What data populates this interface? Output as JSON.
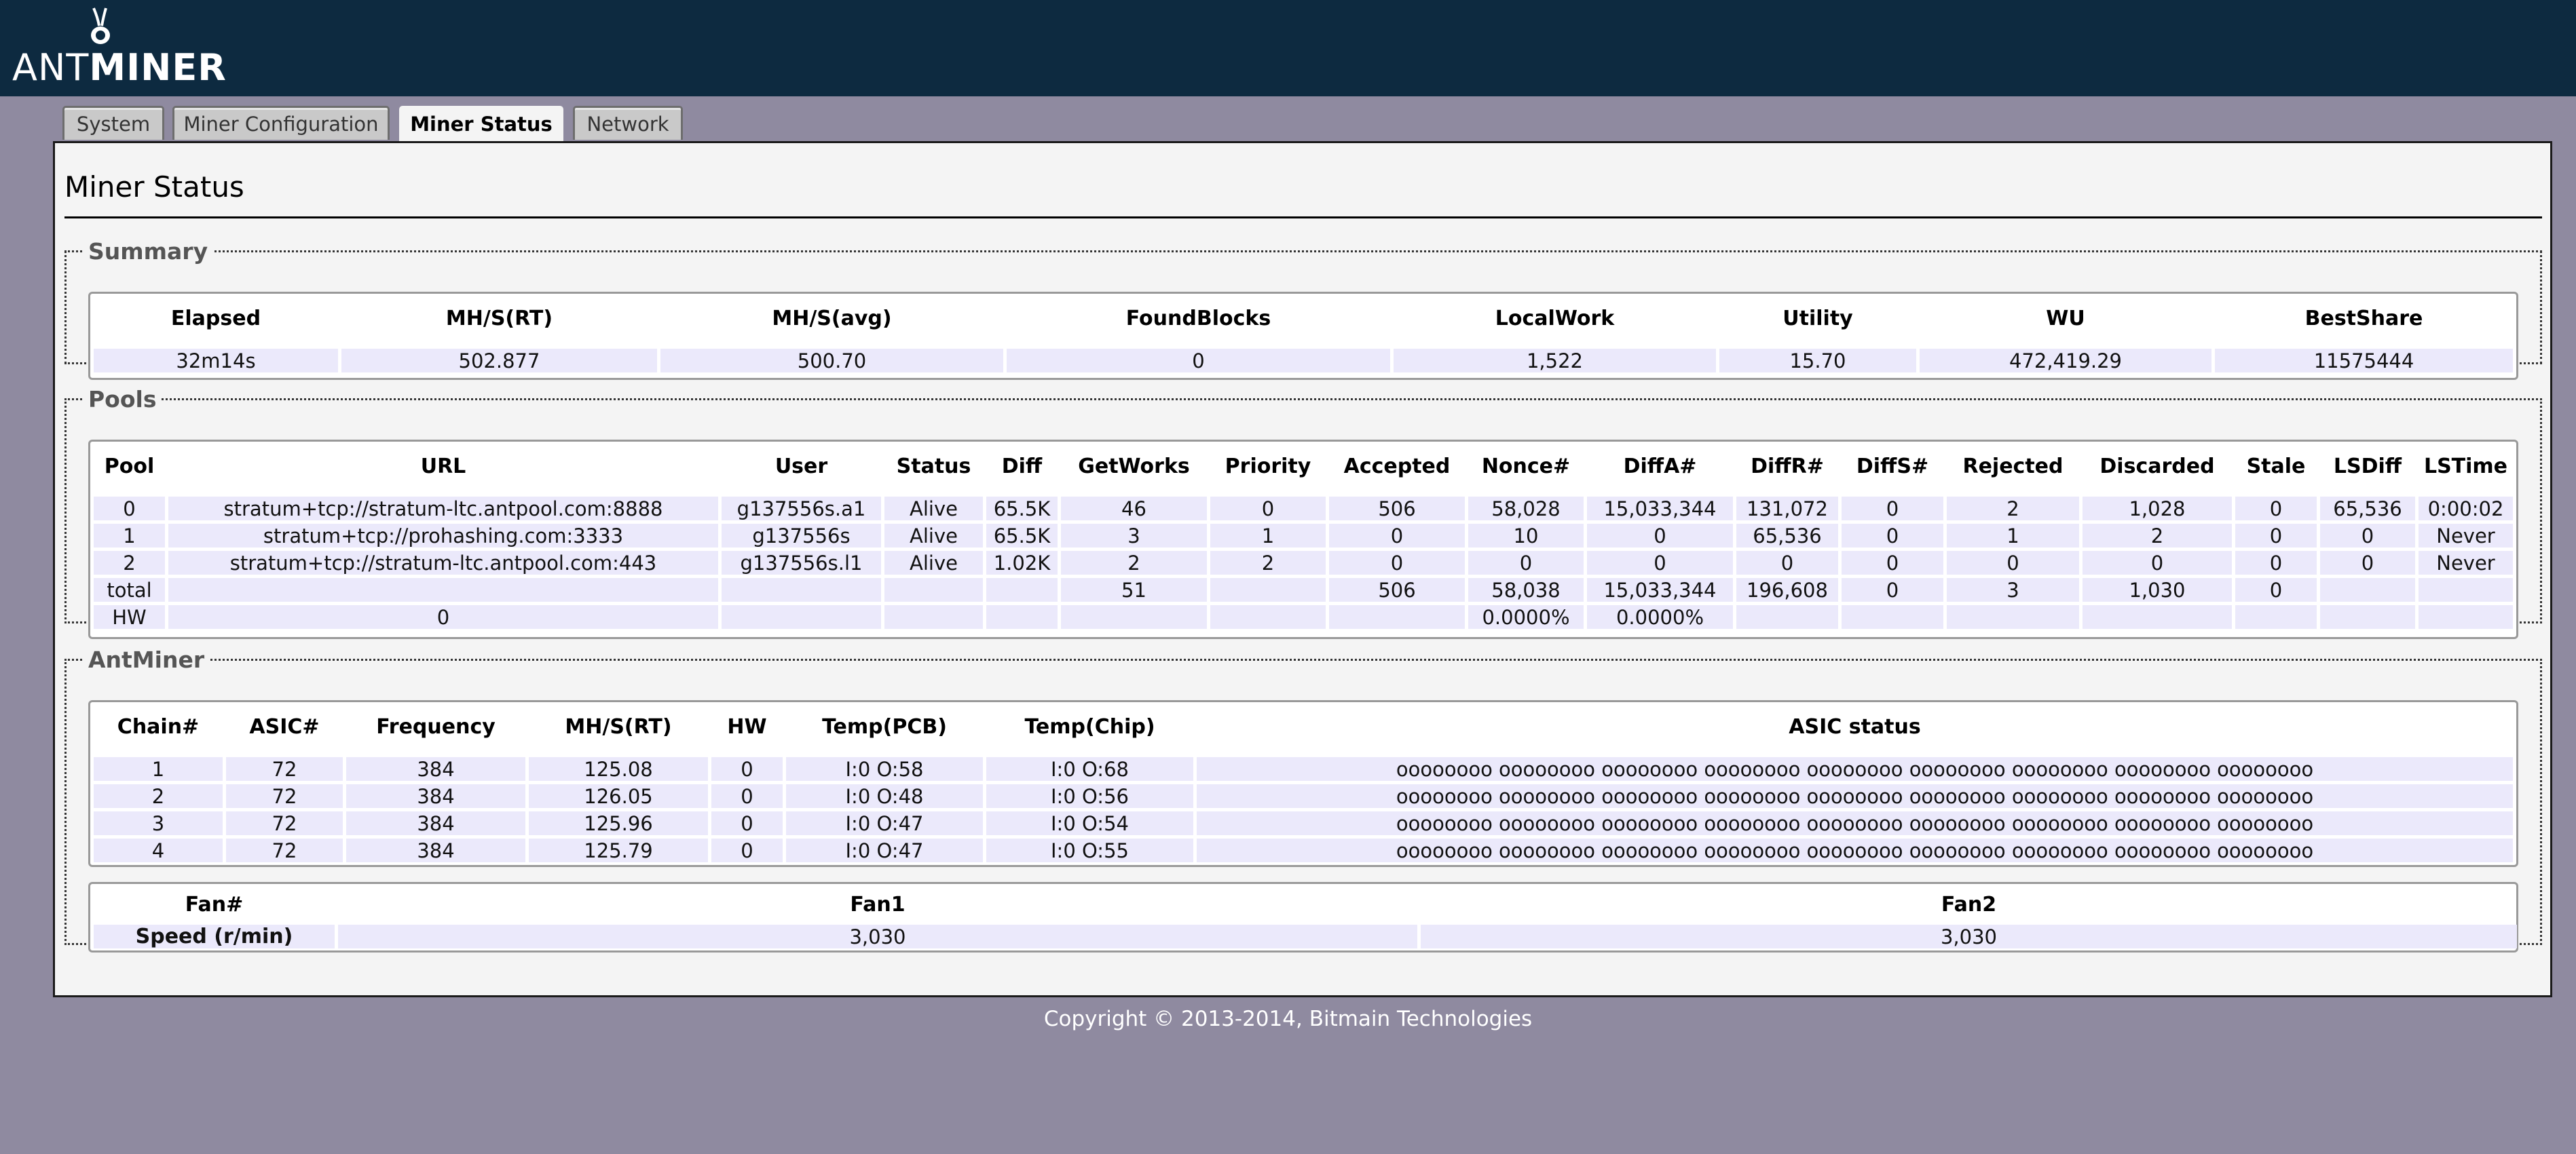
{
  "brand": {
    "part1": "ANT",
    "part2": "MINER"
  },
  "tabs": [
    "System",
    "Miner Configuration",
    "Miner Status",
    "Network"
  ],
  "page_title": "Miner Status",
  "summary": {
    "legend": "Summary",
    "headers": [
      "Elapsed",
      "MH/S(RT)",
      "MH/S(avg)",
      "FoundBlocks",
      "LocalWork",
      "Utility",
      "WU",
      "BestShare"
    ],
    "values": [
      "32m14s",
      "502.877",
      "500.70",
      "0",
      "1,522",
      "15.70",
      "472,419.29",
      "11575444"
    ]
  },
  "pools": {
    "legend": "Pools",
    "headers": [
      "Pool",
      "URL",
      "User",
      "Status",
      "Diff",
      "GetWorks",
      "Priority",
      "Accepted",
      "Nonce#",
      "DiffA#",
      "DiffR#",
      "DiffS#",
      "Rejected",
      "Discarded",
      "Stale",
      "LSDiff",
      "LSTime"
    ],
    "rows": [
      [
        "0",
        "stratum+tcp://stratum-ltc.antpool.com:8888",
        "g137556s.a1",
        "Alive",
        "65.5K",
        "46",
        "0",
        "506",
        "58,028",
        "15,033,344",
        "131,072",
        "0",
        "2",
        "1,028",
        "0",
        "65,536",
        "0:00:02"
      ],
      [
        "1",
        "stratum+tcp://prohashing.com:3333",
        "g137556s",
        "Alive",
        "65.5K",
        "3",
        "1",
        "0",
        "10",
        "0",
        "65,536",
        "0",
        "1",
        "2",
        "0",
        "0",
        "Never"
      ],
      [
        "2",
        "stratum+tcp://stratum-ltc.antpool.com:443",
        "g137556s.l1",
        "Alive",
        "1.02K",
        "2",
        "2",
        "0",
        "0",
        "0",
        "0",
        "0",
        "0",
        "0",
        "0",
        "0",
        "Never"
      ],
      [
        "total",
        "",
        "",
        "",
        "",
        "51",
        "",
        "506",
        "58,038",
        "15,033,344",
        "196,608",
        "0",
        "3",
        "1,030",
        "0",
        "",
        ""
      ],
      [
        "HW",
        "0",
        "",
        "",
        "",
        "",
        "",
        "",
        "0.0000%",
        "0.0000%",
        "",
        "",
        "",
        "",
        "",
        "",
        ""
      ]
    ]
  },
  "antminer": {
    "legend": "AntMiner",
    "headers": [
      "Chain#",
      "ASIC#",
      "Frequency",
      "MH/S(RT)",
      "HW",
      "Temp(PCB)",
      "Temp(Chip)",
      "ASIC status"
    ],
    "rows": [
      [
        "1",
        "72",
        "384",
        "125.08",
        "0",
        "I:0 O:58",
        "I:0 O:68",
        "oooooooo oooooooo oooooooo oooooooo oooooooo oooooooo oooooooo oooooooo oooooooo"
      ],
      [
        "2",
        "72",
        "384",
        "126.05",
        "0",
        "I:0 O:48",
        "I:0 O:56",
        "oooooooo oooooooo oooooooo oooooooo oooooooo oooooooo oooooooo oooooooo oooooooo"
      ],
      [
        "3",
        "72",
        "384",
        "125.96",
        "0",
        "I:0 O:47",
        "I:0 O:54",
        "oooooooo oooooooo oooooooo oooooooo oooooooo oooooooo oooooooo oooooooo oooooooo"
      ],
      [
        "4",
        "72",
        "384",
        "125.79",
        "0",
        "I:0 O:47",
        "I:0 O:55",
        "oooooooo oooooooo oooooooo oooooooo oooooooo oooooooo oooooooo oooooooo oooooooo"
      ]
    ],
    "fan": {
      "headers": [
        "Fan#",
        "Fan1",
        "Fan2"
      ],
      "row_label": "Speed (r/min)",
      "values": [
        "3,030",
        "3,030"
      ]
    }
  },
  "footer": "Copyright © 2013-2014, Bitmain Technologies"
}
